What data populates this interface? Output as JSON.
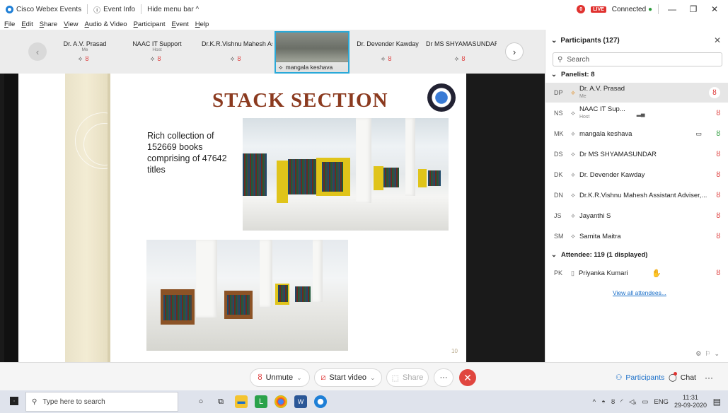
{
  "titlebar": {
    "app": "Cisco Webex Events",
    "event_info": "Event Info",
    "hide_menu": "Hide menu bar ^",
    "status": "Connected",
    "badge_count": "0",
    "live": "LIVE"
  },
  "menu": [
    "File",
    "Edit",
    "Share",
    "View",
    "Audio & Video",
    "Participant",
    "Event",
    "Help"
  ],
  "strip": [
    {
      "name": "Dr. A.V. Prasad",
      "role": "Me"
    },
    {
      "name": "NAAC IT Support",
      "role": "Host"
    },
    {
      "name": "Dr.K.R.Vishnu Mahesh As...",
      "role": ""
    },
    {
      "name": "mangala keshava",
      "role": "",
      "video": true
    },
    {
      "name": "Dr. Devender Kawday",
      "role": ""
    },
    {
      "name": "Dr MS SHYAMASUNDAR",
      "role": ""
    }
  ],
  "slide": {
    "title": "STACK SECTION",
    "text": "Rich collection of 152669 books comprising of 47642 titles",
    "page": "10"
  },
  "controls": {
    "unmute": "Unmute",
    "start_video": "Start video",
    "share": "Share",
    "more": "···",
    "participants": "Participants",
    "chat": "Chat"
  },
  "panel": {
    "title": "Participants (127)",
    "search_placeholder": "Search",
    "panelist_header": "Panelist: 8",
    "panelists": [
      {
        "initials": "DP",
        "name": "Dr. A.V. Prasad",
        "sub": "Me"
      },
      {
        "initials": "NS",
        "name": "NAAC IT Sup...",
        "sub": "Host"
      },
      {
        "initials": "MK",
        "name": "mangala keshava",
        "sub": ""
      },
      {
        "initials": "DS",
        "name": "Dr MS SHYAMASUNDAR",
        "sub": ""
      },
      {
        "initials": "DK",
        "name": "Dr. Devender Kawday",
        "sub": ""
      },
      {
        "initials": "DN",
        "name": "Dr.K.R.Vishnu Mahesh Assistant Adviser,...",
        "sub": ""
      },
      {
        "initials": "JS",
        "name": "Jayanthi S",
        "sub": ""
      },
      {
        "initials": "SM",
        "name": "Samita Maitra",
        "sub": ""
      }
    ],
    "attendee_header": "Attendee: 119 (1 displayed)",
    "attendees": [
      {
        "initials": "PK",
        "name": "Priyanka Kumari"
      }
    ],
    "view_all": "View all attendees..."
  },
  "taskbar": {
    "search_placeholder": "Type here to search",
    "lang": "ENG",
    "time": "11:31",
    "date": "29-09-2020"
  }
}
